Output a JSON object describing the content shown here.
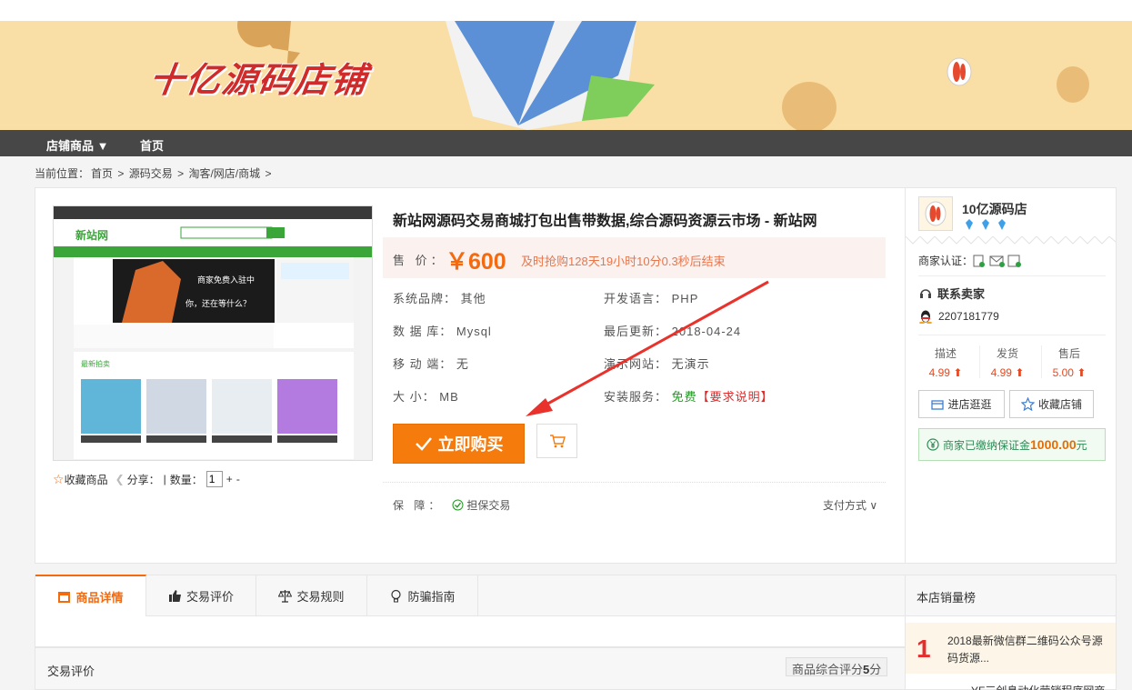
{
  "banner": {
    "shop_title": "十亿源码店铺"
  },
  "nav": {
    "items": [
      "店铺商品 ▼",
      "首页"
    ]
  },
  "breadcrumb": {
    "prefix": "当前位置：",
    "items": [
      "首页",
      ">",
      "源码交易",
      ">",
      "淘客/网店/商城",
      ">"
    ]
  },
  "screenshot": {
    "site_name": "新站网",
    "banner_text_1": "商家免费入驻中",
    "banner_text_2": "你，还在等什么？",
    "section_title": "最新拍卖"
  },
  "product": {
    "title": "新站网源码交易商城打包出售带数据,综合源码资源云市场 - 新站网",
    "price_label": "售 价：",
    "price": "￥600",
    "countdown": "及时抢购128天19小时10分0.3秒后结束",
    "brand_label": "系统品牌：",
    "brand": "其他",
    "lang_label": "开发语言：",
    "lang": "PHP",
    "db_label": "数 据 库：",
    "db": "Mysql",
    "updated_label": "最后更新：",
    "updated": "2018-04-24",
    "mobile_label": "移 动 端：",
    "mobile": "无",
    "demo_label": "演示网站：",
    "demo": "无演示",
    "size_label": "大 小：",
    "size": "MB",
    "install_label": "安装服务：",
    "install": "免费",
    "install_note": "【要求说明】",
    "buy_label": "立即购买",
    "fav_label": "收藏商品",
    "share_label": "分享：",
    "qty_label": "数量：",
    "qty_value": "1",
    "plus": "+",
    "minus": "-",
    "guarantee_label": "保 障：",
    "guarantee": "担保交易",
    "pay_label": "支付方式"
  },
  "seller": {
    "name": "10亿源码店",
    "cert_label": "商家认证：",
    "contact_label": "联系卖家",
    "qq": "2207181779",
    "ratings": [
      {
        "label": "描述",
        "value": "4.99 ⬆"
      },
      {
        "label": "发货",
        "value": "4.99 ⬆"
      },
      {
        "label": "售后",
        "value": "5.00 ⬆"
      }
    ],
    "visit_label": "进店逛逛",
    "fav_shop_label": "收藏店铺",
    "deposit_prefix": "商家已缴纳保证金",
    "deposit_amount": "1000.00",
    "deposit_suffix": "元"
  },
  "tabs": {
    "items": [
      "商品详情",
      "交易评价",
      "交易规则",
      "防骗指南"
    ],
    "review_title": "交易评价",
    "score_prefix": "商品综合评分",
    "score_value": "5",
    "score_suffix": "分"
  },
  "rank": {
    "title": "本店销量榜",
    "item1_num": "1",
    "item1_name": "2018最新微信群二维码公众号源码货源...",
    "item2_name": "YF三创息动化营销程序网商之..."
  },
  "colors": {
    "accent": "#f46a0f",
    "nav_bg": "#474747",
    "banner_bg": "#f9dfa6"
  }
}
